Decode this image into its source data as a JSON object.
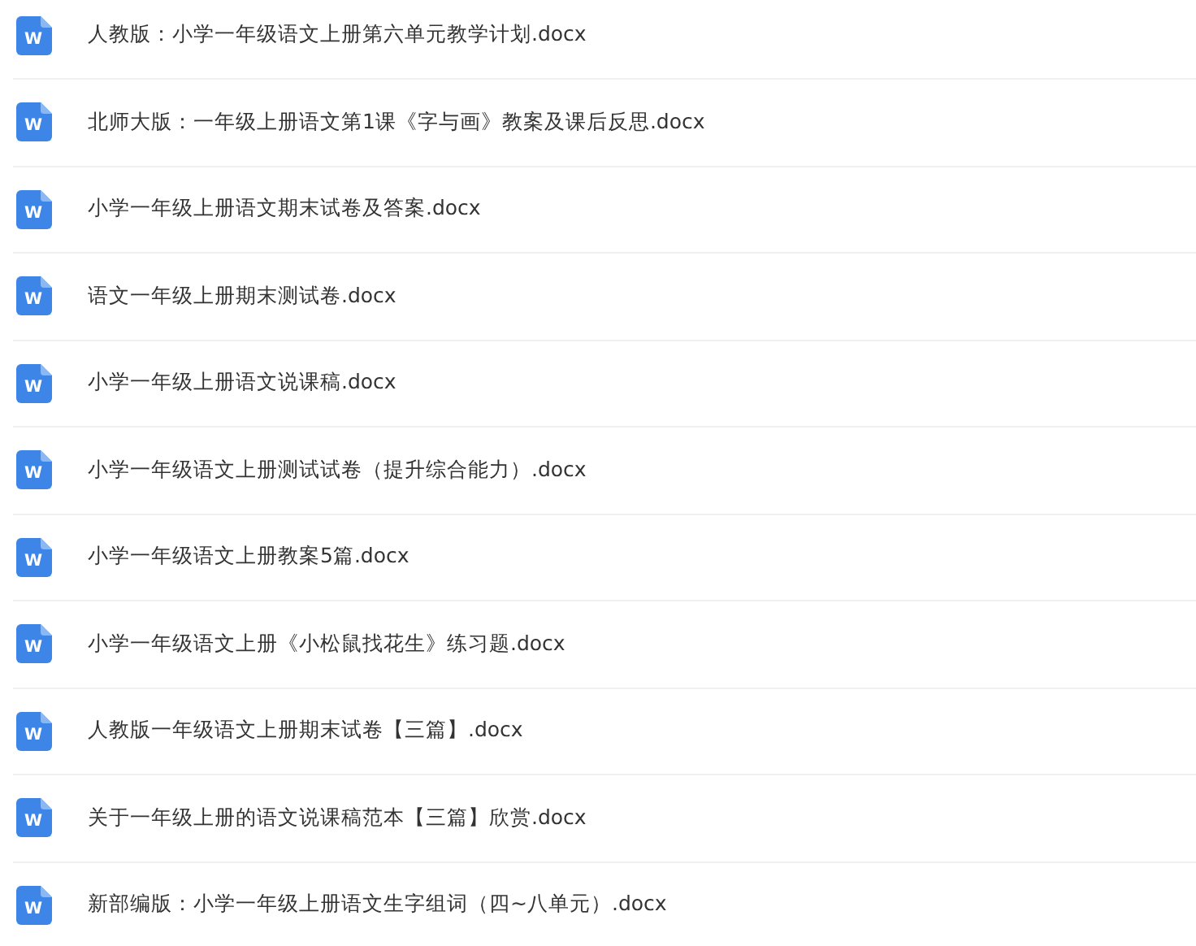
{
  "files": [
    {
      "name": "人教版：小学一年级语文上册第六单元教学计划.docx",
      "icon": "W"
    },
    {
      "name": "北师大版：一年级上册语文第1课《字与画》教案及课后反思.docx",
      "icon": "W"
    },
    {
      "name": "小学一年级上册语文期末试卷及答案.docx",
      "icon": "W"
    },
    {
      "name": "语文一年级上册期末测试卷.docx",
      "icon": "W"
    },
    {
      "name": "小学一年级上册语文说课稿.docx",
      "icon": "W"
    },
    {
      "name": "小学一年级语文上册测试试卷（提升综合能力）.docx",
      "icon": "W"
    },
    {
      "name": "小学一年级语文上册教案5篇.docx",
      "icon": "W"
    },
    {
      "name": "小学一年级语文上册《小松鼠找花生》练习题.docx",
      "icon": "W"
    },
    {
      "name": "人教版一年级语文上册期末试卷【三篇】.docx",
      "icon": "W"
    },
    {
      "name": "关于一年级上册的语文说课稿范本【三篇】欣赏.docx",
      "icon": "W"
    },
    {
      "name": "新部编版：小学一年级上册语文生字组词（四~八单元）.docx",
      "icon": "W"
    }
  ]
}
